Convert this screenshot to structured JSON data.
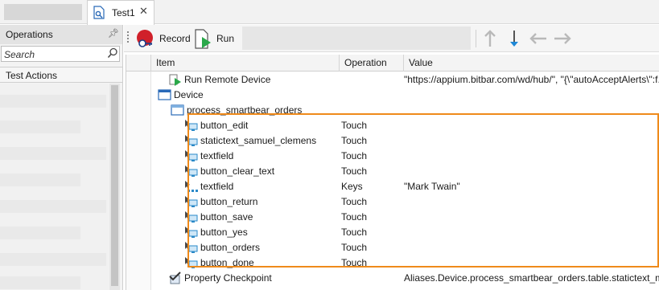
{
  "tabs": {
    "active_tab_label": "Test1",
    "close_glyph": "✕"
  },
  "left_panel": {
    "title": "Operations",
    "search_placeholder": "Search",
    "category": "Test Actions"
  },
  "toolbar": {
    "record_label": "Record",
    "run_label": "Run",
    "icons": [
      "record-icon",
      "run-icon",
      "move-up-icon",
      "move-down-icon",
      "move-left-icon",
      "move-right-icon"
    ]
  },
  "grid": {
    "columns": [
      "Item",
      "Operation",
      "Value"
    ],
    "rows": [
      {
        "item": "Run Remote Device",
        "operation": "",
        "value": "\"https://appium.bitbar.com/wd/hub/\", \"{\\\"autoAcceptAlerts\\\":f...",
        "icon": "run-device-icon"
      },
      {
        "item": "Device",
        "operation": "",
        "value": "",
        "icon": "device-icon",
        "expanded": true
      },
      {
        "item": "process_smartbear_orders",
        "operation": "",
        "value": "",
        "icon": "window-icon",
        "expanded": true
      },
      {
        "item": "button_edit",
        "operation": "Touch",
        "value": "",
        "icon": "touch-icon"
      },
      {
        "item": "statictext_samuel_clemens",
        "operation": "Touch",
        "value": "",
        "icon": "touch-icon"
      },
      {
        "item": "textfield",
        "operation": "Touch",
        "value": "",
        "icon": "touch-icon"
      },
      {
        "item": "button_clear_text",
        "operation": "Touch",
        "value": "",
        "icon": "touch-icon"
      },
      {
        "item": "textfield",
        "operation": "Keys",
        "value": "\"Mark Twain\"",
        "icon": "keys-icon"
      },
      {
        "item": "button_return",
        "operation": "Touch",
        "value": "",
        "icon": "touch-icon"
      },
      {
        "item": "button_save",
        "operation": "Touch",
        "value": "",
        "icon": "touch-icon"
      },
      {
        "item": "button_yes",
        "operation": "Touch",
        "value": "",
        "icon": "touch-icon"
      },
      {
        "item": "button_orders",
        "operation": "Touch",
        "value": "",
        "icon": "touch-icon"
      },
      {
        "item": "button_done",
        "operation": "Touch",
        "value": "",
        "icon": "touch-icon"
      },
      {
        "item": "Property Checkpoint",
        "operation": "",
        "value": "Aliases.Device.process_smartbear_orders.table.statictext_ma...",
        "icon": "checkpoint-icon"
      }
    ]
  },
  "colors": {
    "highlight": "#ef8a1a",
    "record_red": "#d0202a",
    "run_green": "#2aa84a",
    "arrow_blue": "#1e88d6"
  }
}
